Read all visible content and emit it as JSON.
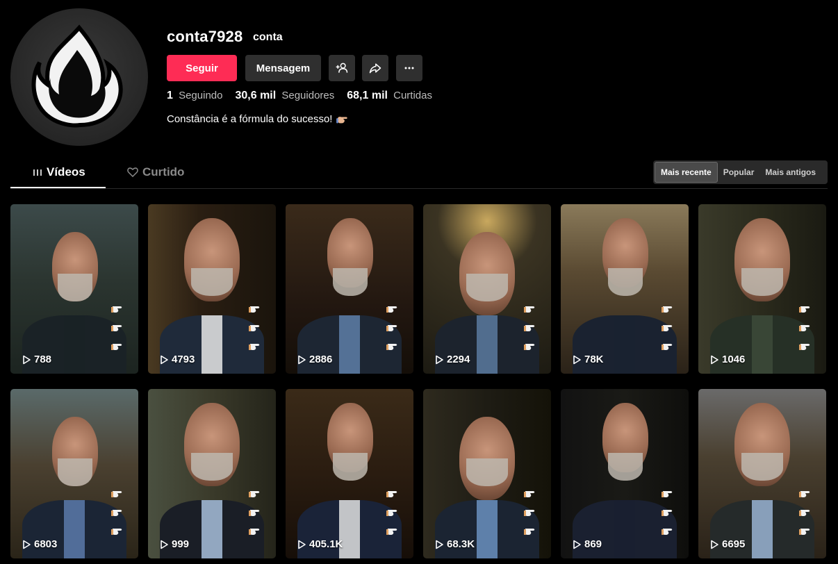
{
  "profile": {
    "username": "conta7928",
    "nickname": "conta",
    "follow_label": "Seguir",
    "message_label": "Mensagem",
    "bio": "Constância é a fórmula do sucesso!",
    "avatar_icon": "flame-logo-icon",
    "bio_emoji": "hand-emoji-icon"
  },
  "stats": {
    "following_count": "1",
    "following_label": "Seguindo",
    "followers_count": "30,6 mil",
    "followers_label": "Seguidores",
    "likes_count": "68,1 mil",
    "likes_label": "Curtidas"
  },
  "tabs": {
    "videos_label": "Vídeos",
    "liked_label": "Curtido"
  },
  "sort": {
    "options": [
      "Mais recente",
      "Popular",
      "Mais antigos"
    ],
    "active": "Mais recente"
  },
  "colors": {
    "accent": "#fe2c55",
    "button_bg": "#2f2f2f"
  },
  "videos": [
    {
      "views": "788"
    },
    {
      "views": "4793"
    },
    {
      "views": "2886"
    },
    {
      "views": "2294"
    },
    {
      "views": "78K"
    },
    {
      "views": "1046"
    },
    {
      "views": "6803"
    },
    {
      "views": "999"
    },
    {
      "views": "405.1K"
    },
    {
      "views": "68.3K"
    },
    {
      "views": "869"
    },
    {
      "views": "6695"
    }
  ]
}
